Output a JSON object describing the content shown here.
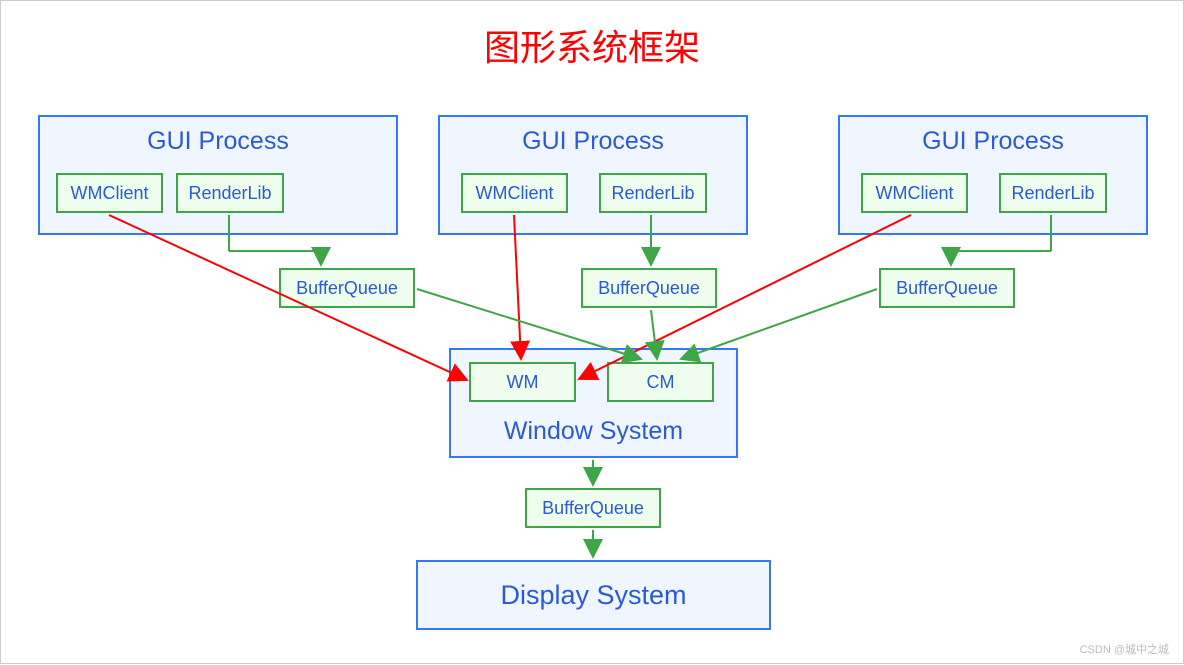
{
  "title": "图形系统框架",
  "gui": {
    "header": "GUI Process",
    "wmclient": "WMClient",
    "renderlib": "RenderLib"
  },
  "bufferqueue": "BufferQueue",
  "ws": {
    "wm": "WM",
    "cm": "CM",
    "title": "Window System"
  },
  "display": "Display System",
  "watermark": "CSDN @城中之城"
}
